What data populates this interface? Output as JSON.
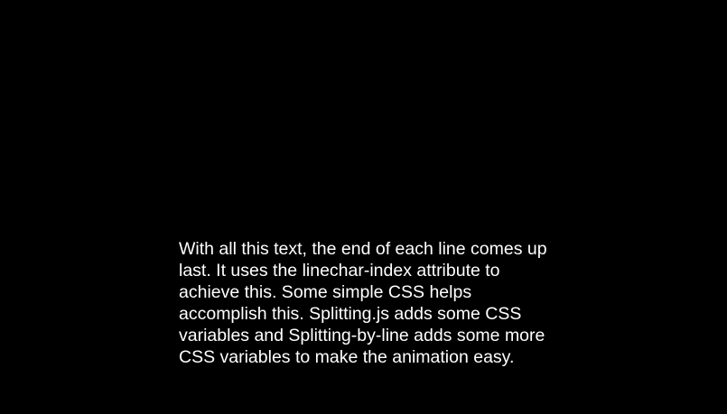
{
  "colors": {
    "background": "#000000",
    "text": "#ffffff"
  },
  "text": {
    "lines": [
      "With all this text, the end of each line comes up",
      "last. It uses the linechar-index attribute to",
      "achieve this. Some simple CSS helps",
      "accomplish this. Splitting.js adds some CSS",
      "variables and Splitting-by-line adds some more",
      "CSS variables to make the animation easy."
    ]
  }
}
